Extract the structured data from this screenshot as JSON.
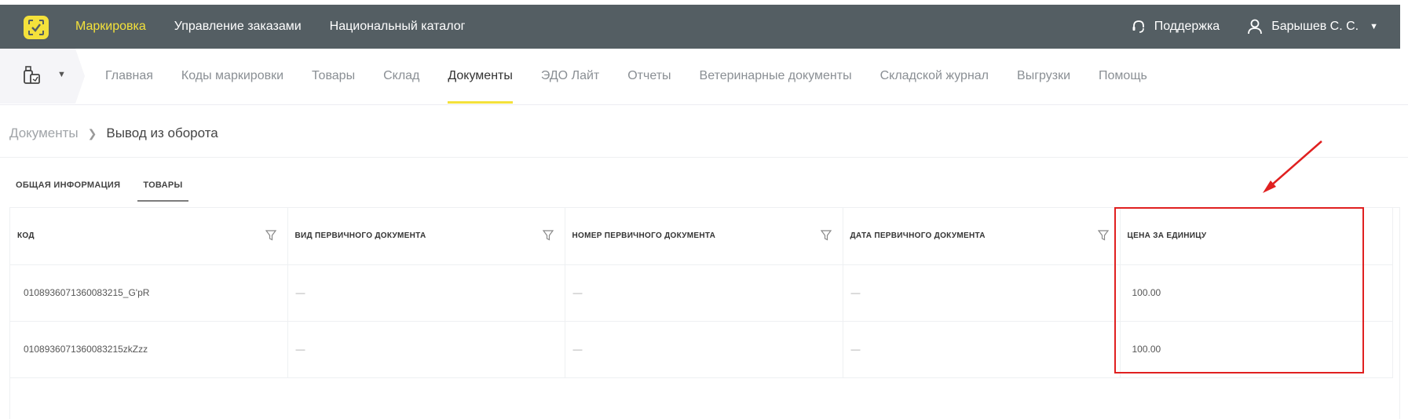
{
  "topbar": {
    "nav": [
      {
        "label": "Маркировка",
        "active": true
      },
      {
        "label": "Управление заказами",
        "active": false
      },
      {
        "label": "Национальный каталог",
        "active": false
      }
    ],
    "support_label": "Поддержка",
    "user_label": "Барышев С. С.",
    "colors": {
      "bar": "#545e63",
      "accent": "#f4e13b"
    }
  },
  "subnav": {
    "items": [
      {
        "label": "Главная"
      },
      {
        "label": "Коды маркировки"
      },
      {
        "label": "Товары"
      },
      {
        "label": "Склад"
      },
      {
        "label": "Документы",
        "active": true
      },
      {
        "label": "ЭДО Лайт"
      },
      {
        "label": "Отчеты"
      },
      {
        "label": "Ветеринарные документы"
      },
      {
        "label": "Складской журнал"
      },
      {
        "label": "Выгрузки"
      },
      {
        "label": "Помощь"
      }
    ]
  },
  "breadcrumb": {
    "parent": "Документы",
    "current": "Вывод из оборота"
  },
  "tabs": [
    {
      "label": "ОБЩАЯ ИНФОРМАЦИЯ"
    },
    {
      "label": "ТОВАРЫ",
      "active": true
    }
  ],
  "table": {
    "columns": [
      {
        "label": "КОД"
      },
      {
        "label": "ВИД ПЕРВИЧНОГО ДОКУМЕНТА"
      },
      {
        "label": "НОМЕР ПЕРВИЧНОГО ДОКУМЕНТА"
      },
      {
        "label": "ДАТА ПЕРВИЧНОГО ДОКУМЕНТА"
      },
      {
        "label": "ЦЕНА ЗА ЕДИНИЦУ"
      }
    ],
    "rows": [
      [
        "0108936071360083215_G'pR",
        "—",
        "—",
        "—",
        "100.00"
      ],
      [
        "0108936071360083215zkZzz",
        "—",
        "—",
        "—",
        "100.00"
      ]
    ]
  },
  "annotation": {
    "color": "#e02020"
  }
}
